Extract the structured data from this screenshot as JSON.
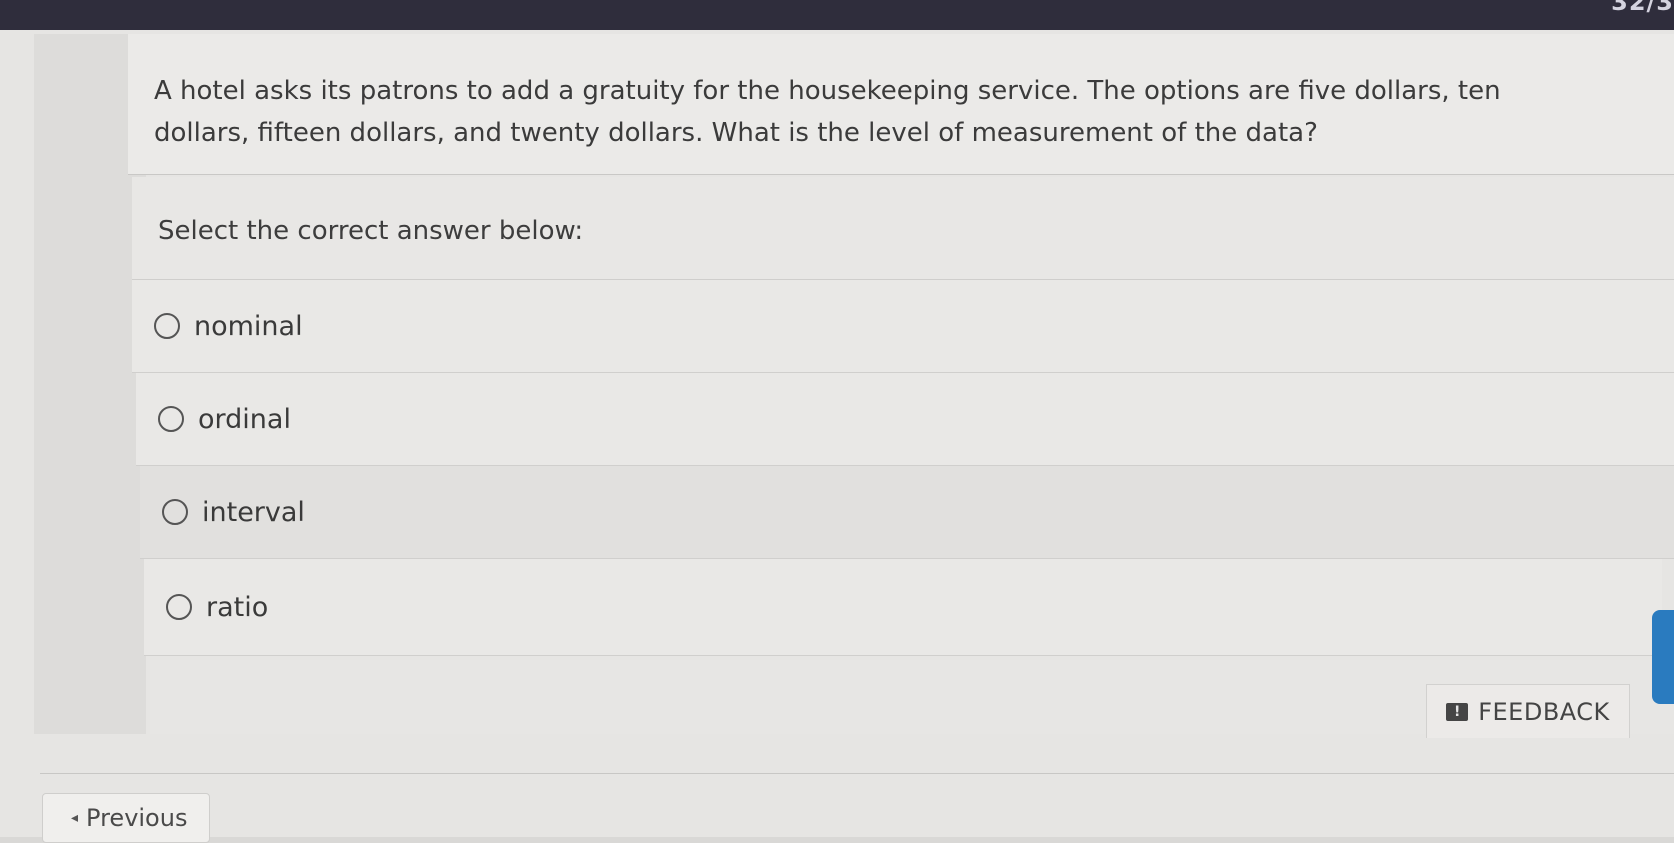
{
  "header": {
    "counter": "32/3"
  },
  "question": {
    "text": "A hotel asks its patrons to add a gratuity for the housekeeping service. The options are five dollars, ten dollars, fifteen dollars, and twenty dollars. What is the level of measurement of the data?",
    "prompt": "Select the correct answer below:",
    "options": [
      {
        "label": "nominal"
      },
      {
        "label": "ordinal"
      },
      {
        "label": "interval"
      },
      {
        "label": "ratio"
      }
    ]
  },
  "feedback": {
    "label": "FEEDBACK",
    "icon": "feedback-icon"
  },
  "nav": {
    "previous_label": "Previous",
    "previous_icon": "caret-left-icon"
  },
  "colors": {
    "topbar": "#2f2d3c",
    "side_tab": "#2a7bbf"
  }
}
